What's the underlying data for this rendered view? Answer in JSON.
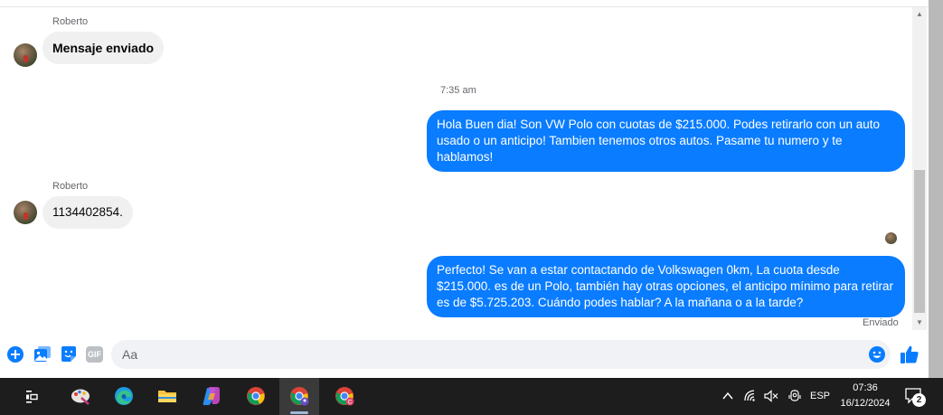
{
  "chat": {
    "messages": [
      {
        "sender": "Roberto",
        "text": "Mensaje enviado"
      },
      {
        "timestamp": "7:35 am"
      },
      {
        "text": "Hola Buen dia! Son VW Polo con cuotas de $215.000. Podes retirarlo con un auto usado o un anticipo! Tambien tenemos otros autos. Pasame tu numero y te hablamos!"
      },
      {
        "sender": "Roberto",
        "text": "1134402854."
      },
      {
        "text": "Perfecto!  Se van a estar contactando de Volkswagen 0km, La cuota desde $215.000. es de un Polo, también hay otras opciones, el anticipo mínimo para retirar es de $5.725.203. Cuándo podes hablar? A la mañana o a la tarde?"
      }
    ],
    "status": "Enviado"
  },
  "composer": {
    "placeholder": "Aa",
    "gif_label": "GIF"
  },
  "taskbar": {
    "language": "ESP",
    "time": "07:36",
    "date": "16/12/2024",
    "notifications_count": "2",
    "badge_letter": "C"
  },
  "colors": {
    "accent": "#0a7cff",
    "incoming_bubble": "#f0f0f0",
    "taskbar": "#1d1d1d"
  }
}
